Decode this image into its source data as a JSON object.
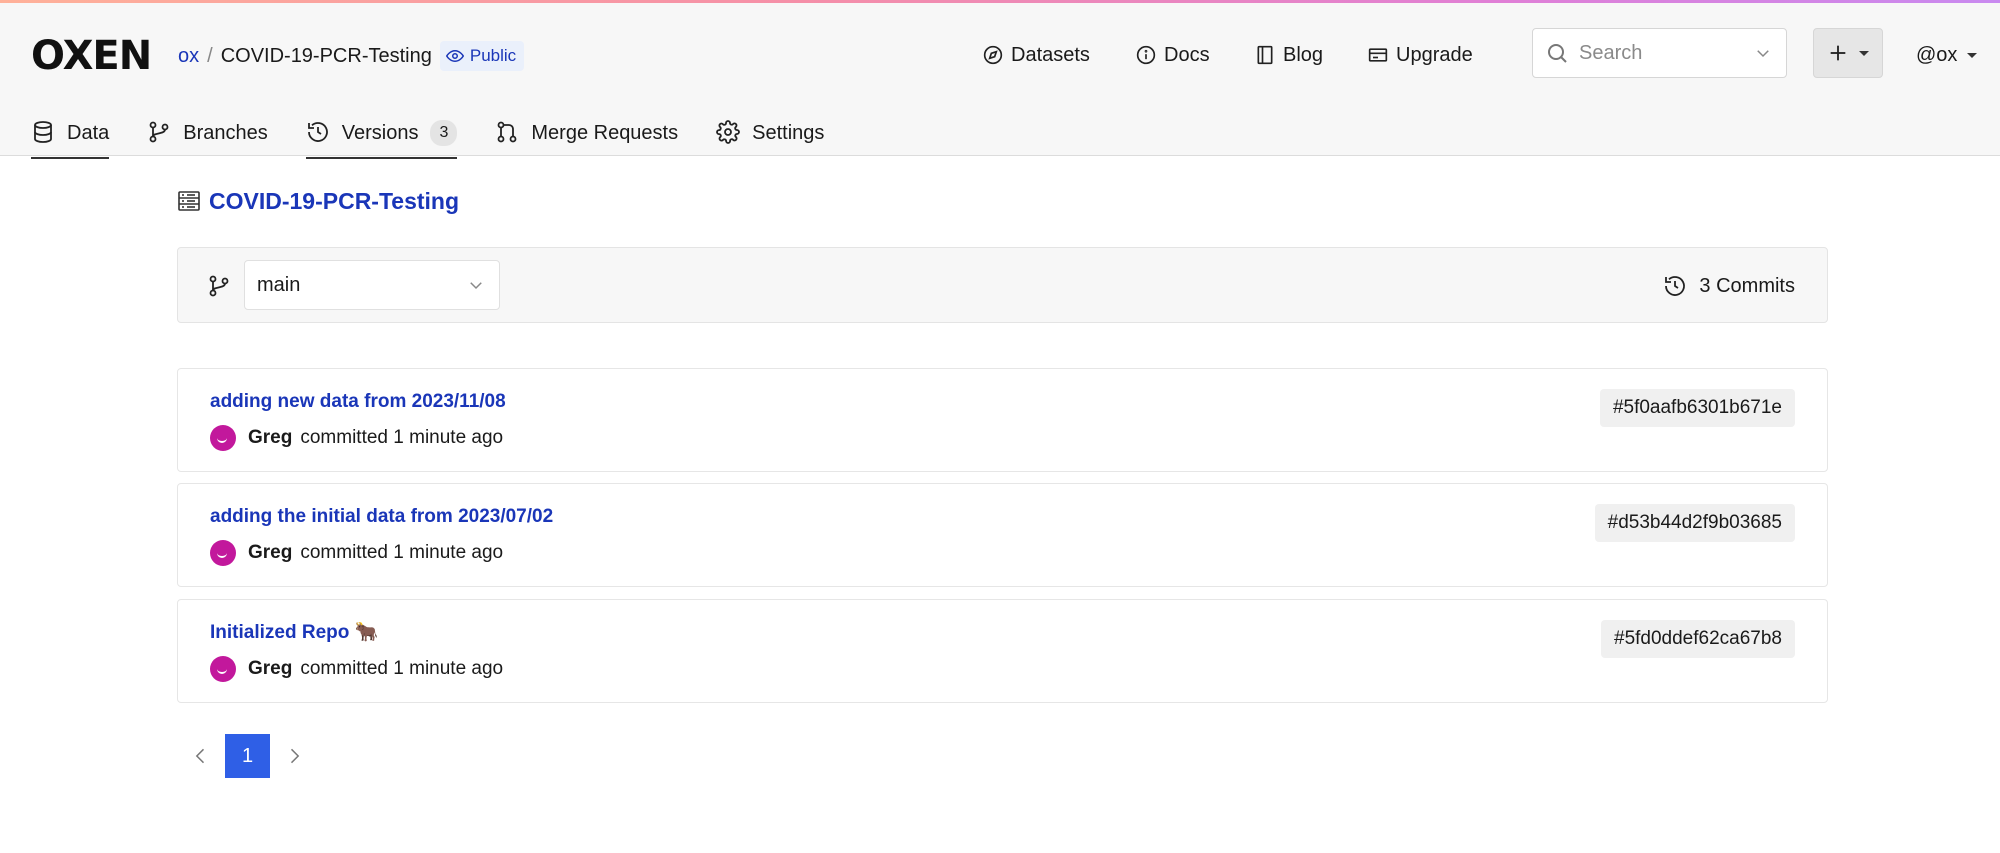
{
  "header": {
    "logo": "OXEN",
    "breadcrumb": {
      "owner": "ox",
      "separator": "/",
      "repo": "COVID-19-PCR-Testing"
    },
    "visibility": "Public",
    "nav": [
      {
        "label": "Datasets",
        "icon": "compass-icon"
      },
      {
        "label": "Docs",
        "icon": "info-icon"
      },
      {
        "label": "Blog",
        "icon": "book-icon"
      },
      {
        "label": "Upgrade",
        "icon": "card-icon"
      }
    ],
    "search": {
      "placeholder": "Search"
    },
    "user": "@ox"
  },
  "tabs": [
    {
      "label": "Data",
      "icon": "database-icon"
    },
    {
      "label": "Branches",
      "icon": "branch-icon"
    },
    {
      "label": "Versions",
      "icon": "history-icon",
      "count": "3"
    },
    {
      "label": "Merge Requests",
      "icon": "merge-request-icon"
    },
    {
      "label": "Settings",
      "icon": "gear-icon"
    }
  ],
  "repo_title": "COVID-19-PCR-Testing",
  "branch": {
    "selected": "main"
  },
  "commits_count": "3 Commits",
  "commits": [
    {
      "message": "adding new data from 2023/11/08",
      "author": "Greg",
      "when": "committed 1 minute ago",
      "hash": "#5f0aafb6301b671e"
    },
    {
      "message": "adding the initial data from 2023/07/02",
      "author": "Greg",
      "when": "committed 1 minute ago",
      "hash": "#d53b44d2f9b03685"
    },
    {
      "message": "Initialized Repo 🐂",
      "author": "Greg",
      "when": "committed 1 minute ago",
      "hash": "#5fd0ddef62ca67b8"
    }
  ],
  "pagination": {
    "current": "1"
  },
  "colors": {
    "link": "#1a36b8",
    "accent": "#2f5fe6",
    "avatar": "#c2189c"
  }
}
